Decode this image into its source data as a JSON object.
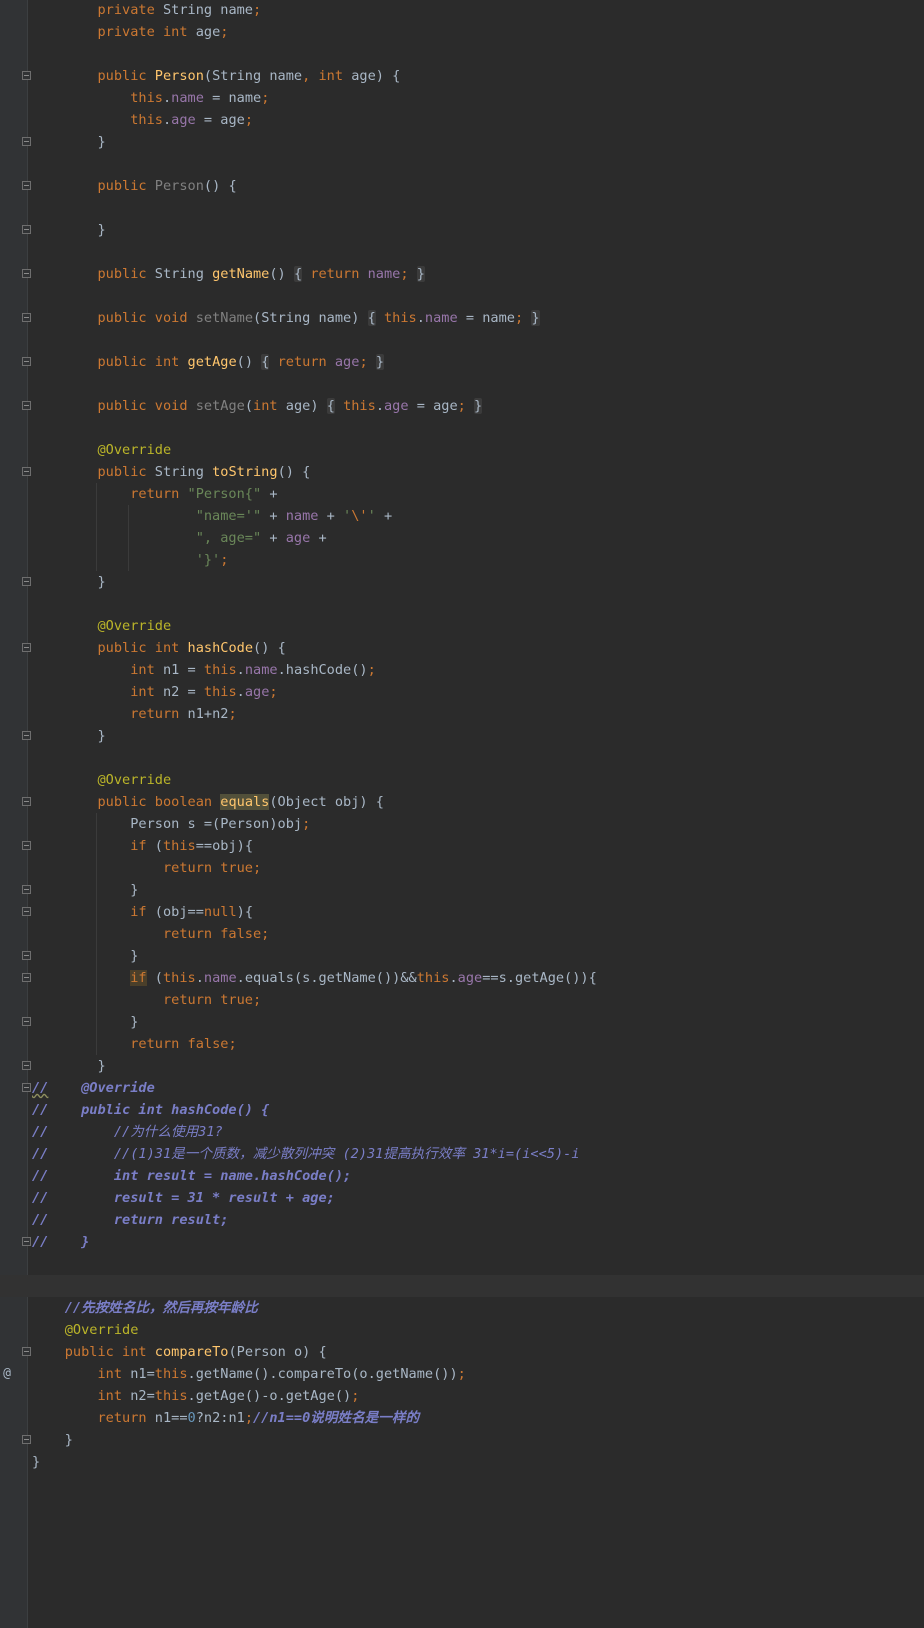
{
  "editor": {
    "language": "java",
    "gutter_icons": {
      "override_marker": "@",
      "override_marker_icon": "override-method-icon"
    },
    "lines": [
      {
        "t": "        private String name;",
        "fold": false
      },
      {
        "t": "        private int age;",
        "fold": false
      },
      {
        "t": "",
        "fold": false
      },
      {
        "t": "        public Person(String name, int age) {",
        "fold": true
      },
      {
        "t": "            this.name = name;",
        "fold": false
      },
      {
        "t": "            this.age = age;",
        "fold": false
      },
      {
        "t": "        }",
        "fold": true
      },
      {
        "t": "",
        "fold": false
      },
      {
        "t": "        public Person() {",
        "fold": true
      },
      {
        "t": "",
        "fold": false
      },
      {
        "t": "        }",
        "fold": true
      },
      {
        "t": "",
        "fold": false
      },
      {
        "t": "        public String getName() { return name; }",
        "fold": true
      },
      {
        "t": "",
        "fold": false
      },
      {
        "t": "        public void setName(String name) { this.name = name; }",
        "fold": true
      },
      {
        "t": "",
        "fold": false
      },
      {
        "t": "        public int getAge() { return age; }",
        "fold": true
      },
      {
        "t": "",
        "fold": false
      },
      {
        "t": "        public void setAge(int age) { this.age = age; }",
        "fold": true
      },
      {
        "t": "",
        "fold": false
      },
      {
        "t": "        @Override",
        "fold": false
      },
      {
        "t": "        public String toString() {",
        "fold": true
      },
      {
        "t": "            return \"Person{\" +",
        "fold": false
      },
      {
        "t": "                    \"name='\" + name + '\\'' +",
        "fold": false
      },
      {
        "t": "                    \", age=\" + age +",
        "fold": false
      },
      {
        "t": "                    '}';",
        "fold": false
      },
      {
        "t": "        }",
        "fold": true
      },
      {
        "t": "",
        "fold": false
      },
      {
        "t": "        @Override",
        "fold": false
      },
      {
        "t": "        public int hashCode() {",
        "fold": true
      },
      {
        "t": "            int n1 = this.name.hashCode();",
        "fold": false
      },
      {
        "t": "            int n2 = this.age;",
        "fold": false
      },
      {
        "t": "            return n1+n2;",
        "fold": false
      },
      {
        "t": "        }",
        "fold": true
      },
      {
        "t": "",
        "fold": false
      },
      {
        "t": "        @Override",
        "fold": false
      },
      {
        "t": "        public boolean equals(Object obj) {",
        "fold": true
      },
      {
        "t": "            Person s =(Person)obj;",
        "fold": false
      },
      {
        "t": "            if (this==obj){",
        "fold": true
      },
      {
        "t": "                return true;",
        "fold": false
      },
      {
        "t": "            }",
        "fold": true
      },
      {
        "t": "            if (obj==null){",
        "fold": true
      },
      {
        "t": "                return false;",
        "fold": false
      },
      {
        "t": "            }",
        "fold": true
      },
      {
        "t": "            if (this.name.equals(s.getName())&&this.age==s.getAge()){",
        "fold": true
      },
      {
        "t": "                return true;",
        "fold": false
      },
      {
        "t": "            }",
        "fold": true
      },
      {
        "t": "            return false;",
        "fold": false
      },
      {
        "t": "        }",
        "fold": true
      },
      {
        "t": "//    @Override",
        "fold": true
      },
      {
        "t": "//    public int hashCode() {",
        "fold": false
      },
      {
        "t": "//        //为什么使用31?",
        "fold": false
      },
      {
        "t": "//        //(1)31是一个质数，减少散列冲突 (2)31提高执行效率 31*i=(i<<5)-i",
        "fold": false
      },
      {
        "t": "//        int result = name.hashCode();",
        "fold": false
      },
      {
        "t": "//        result = 31 * result + age;",
        "fold": false
      },
      {
        "t": "//        return result;",
        "fold": false
      },
      {
        "t": "//    }",
        "fold": true
      },
      {
        "t": "",
        "fold": false
      },
      {
        "t": "",
        "fold": false
      },
      {
        "t": "    //先按姓名比，然后再按年龄比",
        "fold": false
      },
      {
        "t": "    @Override",
        "fold": false
      },
      {
        "t": "    public int compareTo(Person o) {",
        "fold": true
      },
      {
        "t": "        int n1=this.getName().compareTo(o.getName());",
        "fold": false
      },
      {
        "t": "        int n2=this.getAge()-o.getAge();",
        "fold": false
      },
      {
        "t": "        return n1==0?n2:n1;//n1==0说明姓名是一样的",
        "fold": false
      },
      {
        "t": "    }",
        "fold": true
      },
      {
        "t": "}",
        "fold": false
      }
    ]
  }
}
